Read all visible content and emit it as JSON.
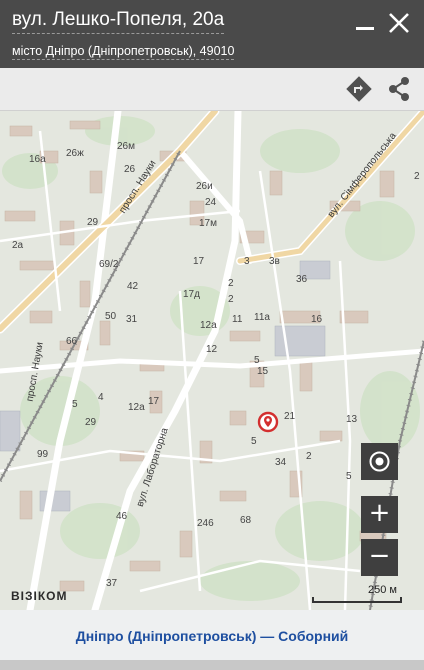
{
  "header": {
    "title": "вул. Лешко-Попеля, 20а",
    "subtitle": "місто Дніпро (Дніпропетровськ), 49010"
  },
  "icons": {
    "minimize": "minimize-icon",
    "close": "close-icon",
    "route": "route-icon",
    "share": "share-icon",
    "marker": "location-pin-icon",
    "locate": "locate-icon"
  },
  "map": {
    "streets": [
      "просп. Науки",
      "просп. Науки",
      "вул. Лабораторна",
      "вул. Сімферопольська"
    ],
    "labels": [
      "26м",
      "16а",
      "26ж",
      "26",
      "26и",
      "24",
      "17м",
      "29",
      "2а",
      "69/2",
      "42",
      "17",
      "17д",
      "50",
      "31",
      "2",
      "12а",
      "11",
      "11а",
      "16",
      "66",
      "5",
      "5",
      "17",
      "12а",
      "4",
      "12",
      "29",
      "21",
      "13",
      "99",
      "5",
      "34",
      "2",
      "46",
      "246",
      "68",
      "37",
      "36",
      "2",
      "15",
      "5",
      "3",
      "3в",
      "2"
    ],
    "zoom_in": "+",
    "zoom_out": "−",
    "scale_label": "250 м",
    "logo": "ВІЗІКОМ"
  },
  "footer": {
    "link": "Дніпро (Дніпропетровськ) — Соборний"
  },
  "colors": {
    "header_bg": "#4a4a4a",
    "marker": "#d32f2f",
    "footer_link": "#1e4fa0"
  }
}
